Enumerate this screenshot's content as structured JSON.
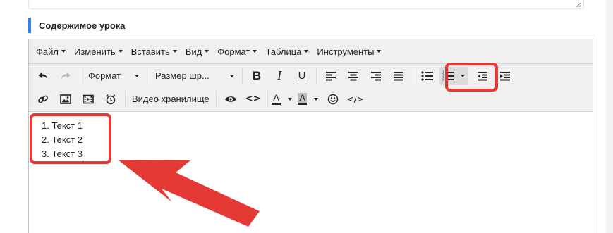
{
  "section": {
    "title": "Содержимое урока"
  },
  "menubar": {
    "items": [
      "Файл",
      "Изменить",
      "Вставить",
      "Вид",
      "Формат",
      "Таблица",
      "Инструменты"
    ]
  },
  "toolbar": {
    "format_select": "Формат",
    "font_size_select": "Размер шр...",
    "bold": "B",
    "italic": "I",
    "underline": "U",
    "video_storage": "Видео хранилище",
    "text_color_letter": "A",
    "bg_color_letter": "A",
    "code_inline": "<>",
    "source_code": "</>"
  },
  "content": {
    "list": [
      "Текст 1",
      "Текст 2",
      "Текст 3"
    ],
    "numbers": [
      "1.",
      "2.",
      "3."
    ]
  },
  "colors": {
    "accent": "#2f80ed",
    "highlight": "#e53935",
    "toolbar_bg": "#f0f0f0"
  },
  "icons": [
    "resize-grip-icon",
    "undo-icon",
    "redo-icon",
    "align-left-icon",
    "align-center-icon",
    "align-right-icon",
    "align-justify-icon",
    "bullet-list-icon",
    "numbered-list-icon",
    "outdent-icon",
    "indent-icon",
    "link-icon",
    "image-icon",
    "media-icon",
    "alarm-clock-icon",
    "eye-icon",
    "emoji-icon",
    "arrow-annotation"
  ]
}
